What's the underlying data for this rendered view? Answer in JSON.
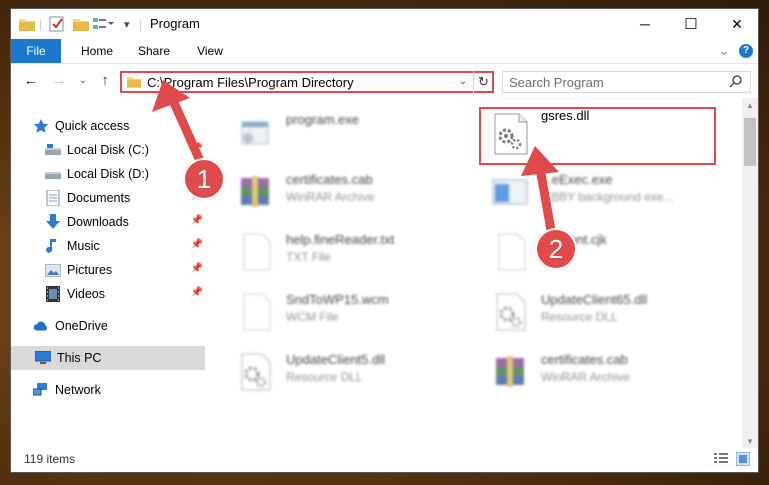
{
  "window": {
    "title": "Program",
    "controls": {
      "minimize": "─",
      "maximize": "☐",
      "close": "✕"
    }
  },
  "ribbon": {
    "tabs": [
      {
        "label": "File"
      },
      {
        "label": "Home"
      },
      {
        "label": "Share"
      },
      {
        "label": "View"
      }
    ],
    "help": "?",
    "expand": "⌄"
  },
  "address": {
    "path": "C:\\Program Files\\Program Directory",
    "refresh": "↻",
    "dropdown": "⌄"
  },
  "search": {
    "placeholder": "Search Program"
  },
  "nav": {
    "back": "←",
    "forward": "→",
    "recent": "⌄",
    "up": "↑",
    "items": [
      {
        "label": "Quick access",
        "icon": "star-icon",
        "pinned": false
      },
      {
        "label": "Local Disk (C:)",
        "icon": "drive-icon",
        "pinned": true
      },
      {
        "label": "Local Disk (D:)",
        "icon": "drive-icon",
        "pinned": false
      },
      {
        "label": "Documents",
        "icon": "documents-icon",
        "pinned": true
      },
      {
        "label": "Downloads",
        "icon": "downloads-icon",
        "pinned": true
      },
      {
        "label": "Music",
        "icon": "music-icon",
        "pinned": true
      },
      {
        "label": "Pictures",
        "icon": "pictures-icon",
        "pinned": true
      },
      {
        "label": "Videos",
        "icon": "videos-icon",
        "pinned": true
      },
      {
        "label": "OneDrive",
        "icon": "onedrive-icon",
        "pinned": false
      },
      {
        "label": "This PC",
        "icon": "this-pc-icon",
        "pinned": false,
        "selected": true
      },
      {
        "label": "Network",
        "icon": "network-icon",
        "pinned": false
      }
    ]
  },
  "files": [
    {
      "name": "program.exe",
      "type": "",
      "icon": "exe-icon",
      "blurred": true
    },
    {
      "name": "gsres.dll",
      "type": "",
      "icon": "dll-gear-icon",
      "blurred": false,
      "highlighted": true
    },
    {
      "name": "certificates.cab",
      "type": "WinRAR Archive",
      "icon": "winrar-icon",
      "blurred": true
    },
    {
      "name": "...eExec.exe",
      "type": "...BBY background exe...",
      "icon": "app-window-icon",
      "blurred": true
    },
    {
      "name": "help.fineReader.txt",
      "type": "TXT File",
      "icon": "blank-file-icon",
      "blurred": true
    },
    {
      "name": "D...Font.cjk",
      "type": "C...",
      "icon": "blank-file-icon",
      "blurred": true
    },
    {
      "name": "SndToWP15.wcm",
      "type": "WCM File",
      "icon": "blank-file-icon",
      "blurred": true
    },
    {
      "name": "UpdateClient65.dll",
      "type": "Resource DLL",
      "icon": "dll-gear-icon",
      "blurred": true
    },
    {
      "name": "UpdateClient5.dll",
      "type": "Resource DLL",
      "icon": "dll-gear-icon",
      "blurred": true
    },
    {
      "name": "certificates.cab",
      "type": "WinRAR Archive",
      "icon": "winrar-icon",
      "blurred": true
    }
  ],
  "status": {
    "count": "119 items"
  },
  "annotations": [
    {
      "label": "1",
      "target": "address-bar"
    },
    {
      "label": "2",
      "target": "gsres-dll"
    }
  ],
  "colors": {
    "accent": "#1979ca",
    "annotation": "#e04a4a",
    "selection": "#d9d9d9"
  }
}
